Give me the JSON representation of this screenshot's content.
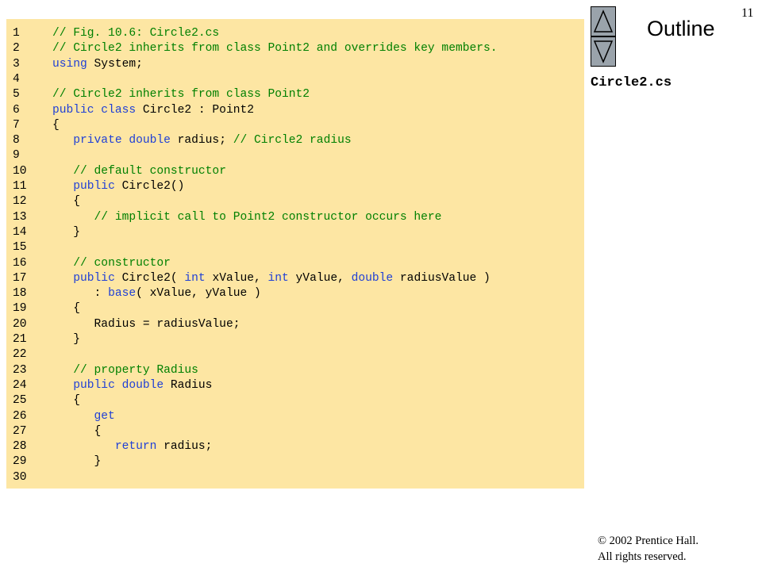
{
  "slide_number": "11",
  "outline_label": "Outline",
  "file_label": "Circle2.cs",
  "copyright": {
    "line1": "© 2002 Prentice Hall.",
    "line2": "All rights reserved."
  },
  "icons": {
    "up": "triangle-up-icon",
    "down": "triangle-down-icon"
  },
  "colors": {
    "panel_background": "#fde6a3",
    "comment": "#008000",
    "keyword": "#1f3fd6",
    "nav_button": "#9aa3ab"
  },
  "code_lines": [
    {
      "num": "1",
      "tokens": [
        {
          "t": "// Fig. 10.6: Circle2.cs",
          "c": "cm"
        }
      ]
    },
    {
      "num": "2",
      "tokens": [
        {
          "t": "// Circle2 inherits from class Point2 and overrides key members.",
          "c": "cm"
        }
      ]
    },
    {
      "num": "3",
      "tokens": [
        {
          "t": "using",
          "c": "kw"
        },
        {
          "t": " System;",
          "c": "tx"
        }
      ]
    },
    {
      "num": "4",
      "tokens": []
    },
    {
      "num": "5",
      "tokens": [
        {
          "t": "// Circle2 inherits from class Point2",
          "c": "cm"
        }
      ]
    },
    {
      "num": "6",
      "tokens": [
        {
          "t": "public class",
          "c": "kw"
        },
        {
          "t": " Circle2 : Point2",
          "c": "tx"
        }
      ]
    },
    {
      "num": "7",
      "tokens": [
        {
          "t": "{",
          "c": "tx"
        }
      ]
    },
    {
      "num": "8",
      "tokens": [
        {
          "t": "   ",
          "c": "tx"
        },
        {
          "t": "private double",
          "c": "kw"
        },
        {
          "t": " radius; ",
          "c": "tx"
        },
        {
          "t": "// Circle2 radius",
          "c": "cm"
        }
      ]
    },
    {
      "num": "9",
      "tokens": []
    },
    {
      "num": "10",
      "tokens": [
        {
          "t": "   ",
          "c": "tx"
        },
        {
          "t": "// default constructor",
          "c": "cm"
        }
      ]
    },
    {
      "num": "11",
      "tokens": [
        {
          "t": "   ",
          "c": "tx"
        },
        {
          "t": "public",
          "c": "kw"
        },
        {
          "t": " Circle2()",
          "c": "tx"
        }
      ]
    },
    {
      "num": "12",
      "tokens": [
        {
          "t": "   {",
          "c": "tx"
        }
      ]
    },
    {
      "num": "13",
      "tokens": [
        {
          "t": "      ",
          "c": "tx"
        },
        {
          "t": "// implicit call to Point2 constructor occurs here",
          "c": "cm"
        }
      ]
    },
    {
      "num": "14",
      "tokens": [
        {
          "t": "   }",
          "c": "tx"
        }
      ]
    },
    {
      "num": "15",
      "tokens": []
    },
    {
      "num": "16",
      "tokens": [
        {
          "t": "   ",
          "c": "tx"
        },
        {
          "t": "// constructor",
          "c": "cm"
        }
      ]
    },
    {
      "num": "17",
      "tokens": [
        {
          "t": "   ",
          "c": "tx"
        },
        {
          "t": "public",
          "c": "kw"
        },
        {
          "t": " Circle2( ",
          "c": "tx"
        },
        {
          "t": "int",
          "c": "kw"
        },
        {
          "t": " xValue, ",
          "c": "tx"
        },
        {
          "t": "int",
          "c": "kw"
        },
        {
          "t": " yValue, ",
          "c": "tx"
        },
        {
          "t": "double",
          "c": "kw"
        },
        {
          "t": " radiusValue )",
          "c": "tx"
        }
      ]
    },
    {
      "num": "18",
      "tokens": [
        {
          "t": "      : ",
          "c": "tx"
        },
        {
          "t": "base",
          "c": "kw"
        },
        {
          "t": "( xValue, yValue )",
          "c": "tx"
        }
      ]
    },
    {
      "num": "19",
      "tokens": [
        {
          "t": "   {",
          "c": "tx"
        }
      ]
    },
    {
      "num": "20",
      "tokens": [
        {
          "t": "      Radius = radiusValue;",
          "c": "tx"
        }
      ]
    },
    {
      "num": "21",
      "tokens": [
        {
          "t": "   }",
          "c": "tx"
        }
      ]
    },
    {
      "num": "22",
      "tokens": []
    },
    {
      "num": "23",
      "tokens": [
        {
          "t": "   ",
          "c": "tx"
        },
        {
          "t": "// property Radius",
          "c": "cm"
        }
      ]
    },
    {
      "num": "24",
      "tokens": [
        {
          "t": "   ",
          "c": "tx"
        },
        {
          "t": "public double",
          "c": "kw"
        },
        {
          "t": " Radius",
          "c": "tx"
        }
      ]
    },
    {
      "num": "25",
      "tokens": [
        {
          "t": "   {",
          "c": "tx"
        }
      ]
    },
    {
      "num": "26",
      "tokens": [
        {
          "t": "      ",
          "c": "tx"
        },
        {
          "t": "get",
          "c": "kw"
        }
      ]
    },
    {
      "num": "27",
      "tokens": [
        {
          "t": "      {",
          "c": "tx"
        }
      ]
    },
    {
      "num": "28",
      "tokens": [
        {
          "t": "         ",
          "c": "tx"
        },
        {
          "t": "return",
          "c": "kw"
        },
        {
          "t": " radius;",
          "c": "tx"
        }
      ]
    },
    {
      "num": "29",
      "tokens": [
        {
          "t": "      }",
          "c": "tx"
        }
      ]
    },
    {
      "num": "30",
      "tokens": []
    }
  ]
}
